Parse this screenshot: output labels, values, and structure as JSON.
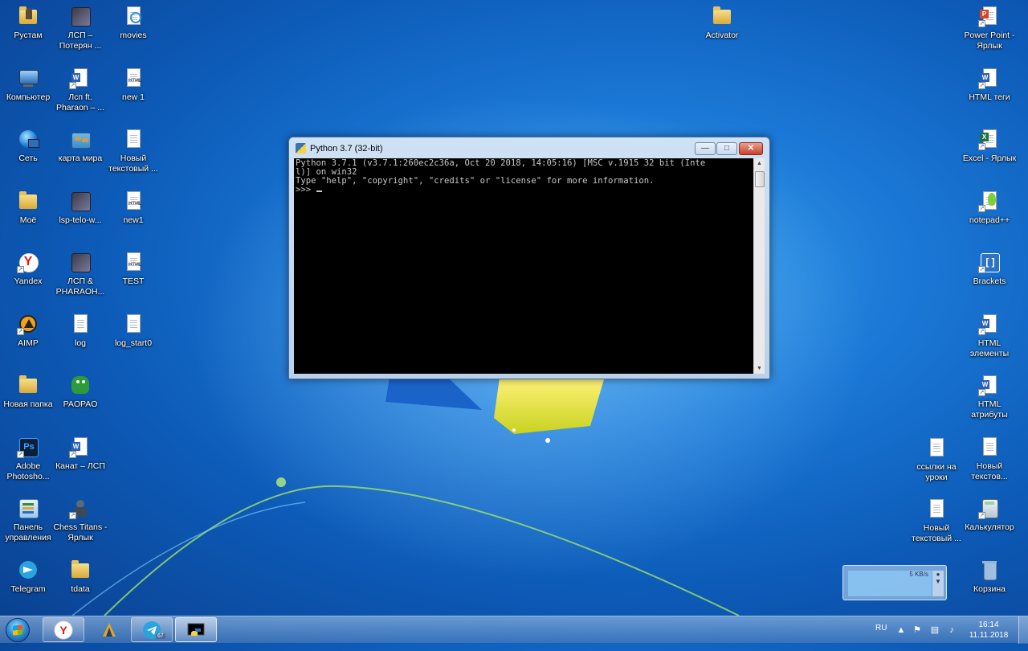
{
  "desktop": {
    "col1": [
      {
        "label": "Рустам",
        "icon": "user-folder-icon"
      },
      {
        "label": "Компьютер",
        "icon": "computer-icon"
      },
      {
        "label": "Сеть",
        "icon": "network-icon"
      },
      {
        "label": "Моё",
        "icon": "folder-icon"
      },
      {
        "label": "Yandex",
        "icon": "yandex-browser-icon"
      },
      {
        "label": "AIMP",
        "icon": "aimp-icon"
      },
      {
        "label": "Новая папка",
        "icon": "folder-icon"
      },
      {
        "label": "Adobe Photosho...",
        "icon": "photoshop-icon"
      },
      {
        "label": "Панель управления",
        "icon": "control-panel-icon"
      },
      {
        "label": "Telegram",
        "icon": "telegram-icon"
      }
    ],
    "col2": [
      {
        "label": "ЛСП – Потерян ...",
        "icon": "image-icon"
      },
      {
        "label": "Лсп ft. Pharaon – ...",
        "icon": "word-doc-icon"
      },
      {
        "label": "карта мира",
        "icon": "map-image-icon"
      },
      {
        "label": "lsp-telo-w...",
        "icon": "image-icon"
      },
      {
        "label": "ЛСП & PHARAOH...",
        "icon": "image-icon"
      },
      {
        "label": "log",
        "icon": "text-file-icon"
      },
      {
        "label": "PAOPAO",
        "icon": "game-icon"
      },
      {
        "label": "Канат – ЛСП",
        "icon": "word-doc-icon"
      },
      {
        "label": "Chess Titans - Ярлык",
        "icon": "chess-icon"
      },
      {
        "label": "tdata",
        "icon": "folder-icon"
      }
    ],
    "col3": [
      {
        "label": "movies",
        "icon": "settings-file-icon"
      },
      {
        "label": "new 1",
        "icon": "html-file-icon"
      },
      {
        "label": "Новый текстовый ...",
        "icon": "text-file-icon"
      },
      {
        "label": "new1",
        "icon": "html-file-icon"
      },
      {
        "label": "TEST",
        "icon": "html-file-icon"
      },
      {
        "label": "log_start0",
        "icon": "text-file-icon"
      }
    ],
    "activator": {
      "label": "Activator",
      "icon": "folder-icon"
    },
    "right_col": [
      {
        "label": "Power Point - Ярлык",
        "icon": "powerpoint-icon"
      },
      {
        "label": "HTML теги",
        "icon": "word-doc-icon"
      },
      {
        "label": "Excel - Ярлык",
        "icon": "excel-icon"
      },
      {
        "label": "notepad++",
        "icon": "notepad-plus-icon"
      },
      {
        "label": "Brackets",
        "icon": "brackets-icon"
      },
      {
        "label": "HTML элементы",
        "icon": "word-doc-icon"
      },
      {
        "label": "HTML атрибуты",
        "icon": "word-doc-icon"
      },
      {
        "label": "Новый текстов...",
        "icon": "text-file-icon"
      },
      {
        "label": "Калькулятор",
        "icon": "calculator-icon"
      },
      {
        "label": "Корзина",
        "icon": "recycle-bin-icon"
      }
    ],
    "second_right": [
      {
        "label": "ссылки на уроки",
        "icon": "text-file-icon"
      },
      {
        "label": "Новый текстовый ...",
        "icon": "text-file-icon"
      }
    ]
  },
  "window": {
    "title": "Python 3.7 (32-bit)",
    "lines": [
      "Python 3.7.1 (v3.7.1:260ec2c36a, Oct 20 2018, 14:05:16) [MSC v.1915 32 bit (Inte",
      "l)] on win32",
      "Type \"help\", \"copyright\", \"credits\" or \"license\" for more information."
    ],
    "prompt": ">>> "
  },
  "gadget": {
    "speed": "5 KB/s"
  },
  "taskbar": {
    "apps": [
      "yandex-browser-icon",
      "game-icon",
      "telegram-icon",
      "python-icon"
    ],
    "telegram_badge": "67",
    "lang": "RU",
    "time": "16:14",
    "date": "11.11.2018"
  },
  "colors": {
    "accent": "#1b78d6",
    "console_bg": "#000000",
    "console_fg": "#c8c8c8"
  }
}
